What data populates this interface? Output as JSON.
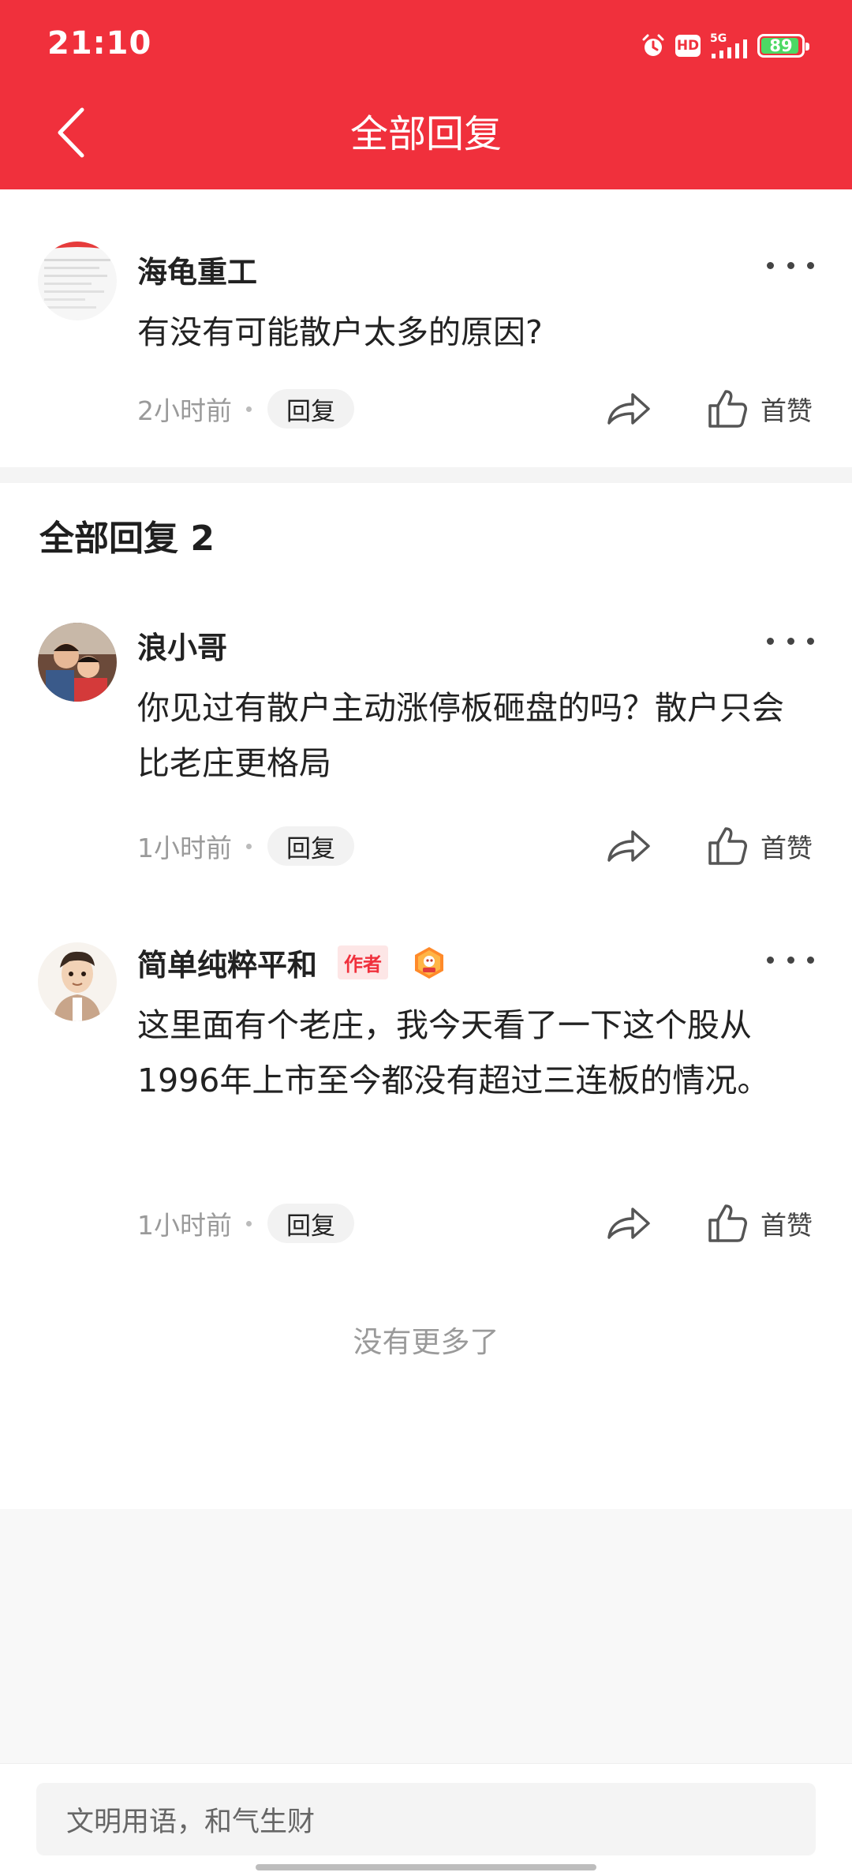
{
  "status_bar": {
    "time": "21:10",
    "hd_label": "HD",
    "battery_level": "89",
    "icons": [
      "alarm-icon",
      "hd-icon",
      "signal-5g-icon",
      "battery-icon"
    ]
  },
  "header": {
    "title": "全部回复",
    "back_icon": "chevron-left-icon",
    "background": "#f0303c"
  },
  "main_comment": {
    "username": "海龟重工",
    "text": "有没有可能散户太多的原因?",
    "time": "2小时前",
    "reply_label": "回复",
    "like_label": "首赞"
  },
  "replies_section": {
    "title": "全部回复 2"
  },
  "replies": [
    {
      "username": "浪小哥",
      "text": "你见过有散户主动涨停板砸盘的吗？散户只会比老庄更格局",
      "time": "1小时前",
      "reply_label": "回复",
      "like_label": "首赞"
    },
    {
      "username": "简单纯粹平和",
      "author_tag": "作者",
      "text": "这里面有个老庄，我今天看了一下这个股从1996年上市至今都没有超过三连板的情况。",
      "time": "1小时前",
      "reply_label": "回复",
      "like_label": "首赞"
    }
  ],
  "footer": {
    "no_more": "没有更多了",
    "input_placeholder": "文明用语，和气生财"
  },
  "colors": {
    "brand_red": "#f0303c",
    "author_tag_bg": "#fde6e6",
    "meta_gray": "#9a9a9a",
    "battery_green": "#4cd964"
  }
}
